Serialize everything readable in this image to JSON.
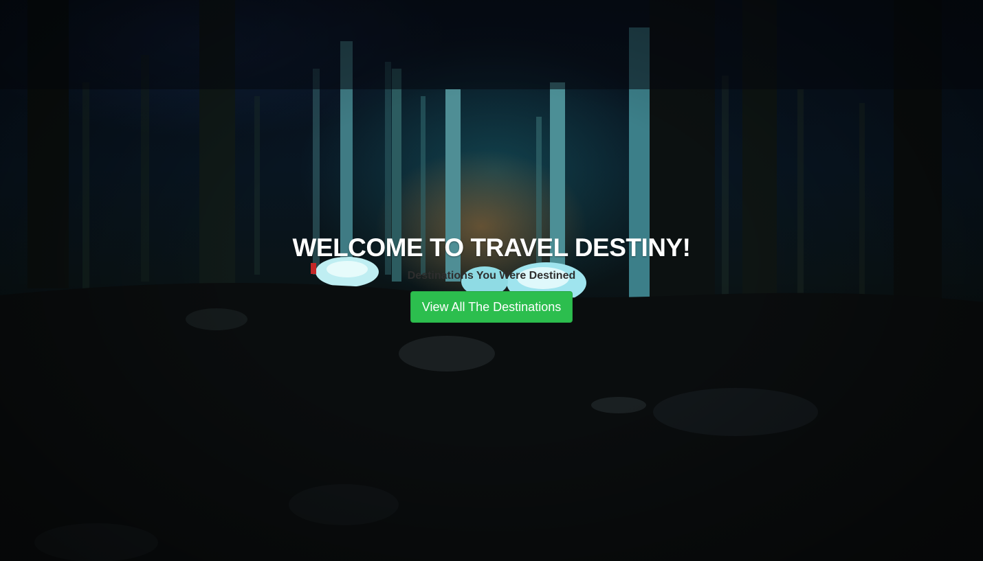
{
  "hero": {
    "title": "WELCOME TO TRAVEL DESTINY!",
    "subtitle": "Destinations You Were Destined",
    "cta_label": "View All The Destinations"
  },
  "colors": {
    "cta_background": "#2cbe4e",
    "cta_text": "#ffffff",
    "title_text": "#ffffff",
    "subtitle_text": "#2e2e2e"
  },
  "background": {
    "icon": "forest-campsite-night-photo"
  }
}
